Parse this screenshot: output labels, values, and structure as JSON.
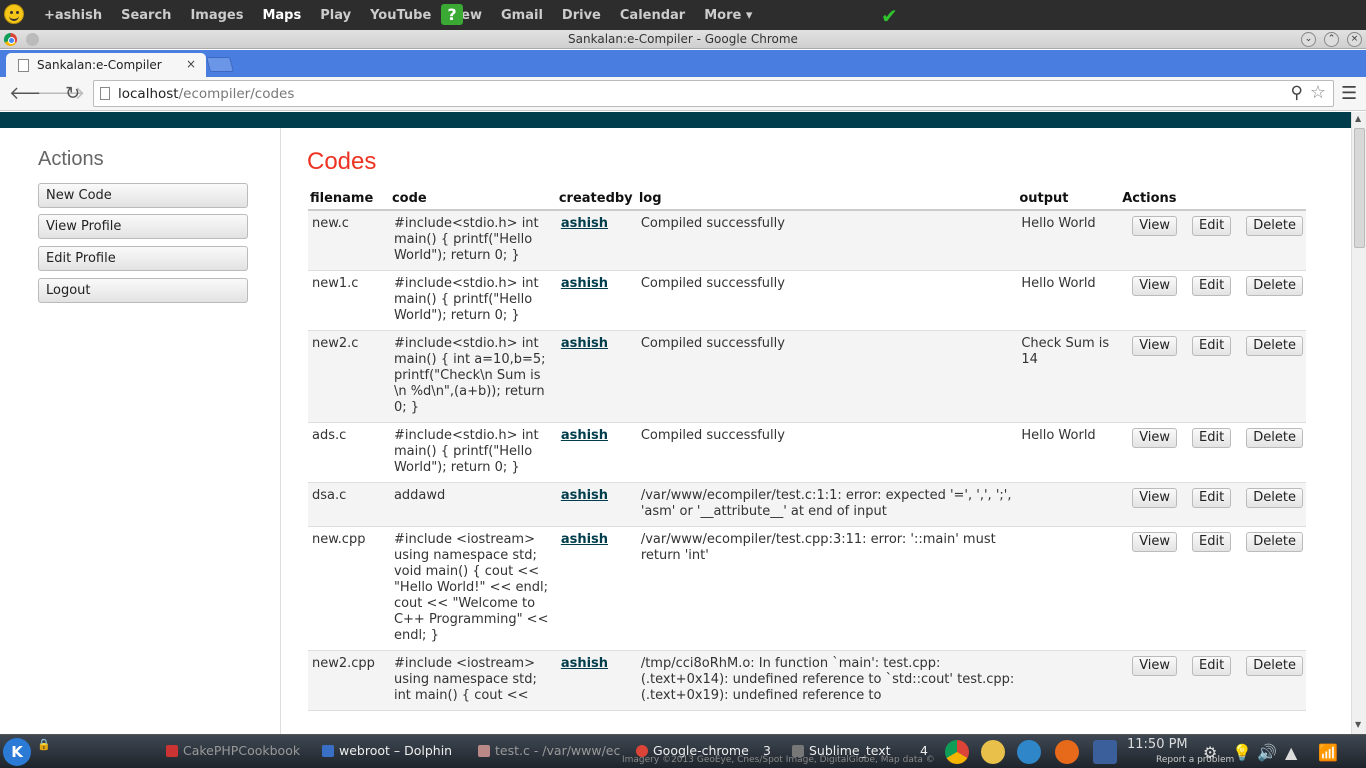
{
  "google_bar": {
    "links": [
      {
        "label": "+ashish",
        "active": false
      },
      {
        "label": "Search",
        "active": false
      },
      {
        "label": "Images",
        "active": false
      },
      {
        "label": "Maps",
        "active": true
      },
      {
        "label": "Play",
        "active": false
      },
      {
        "label": "YouTube",
        "active": false
      },
      {
        "label": "New",
        "active": false
      },
      {
        "label": "Gmail",
        "active": false
      },
      {
        "label": "Drive",
        "active": false
      },
      {
        "label": "Calendar",
        "active": false
      },
      {
        "label": "More ▾",
        "active": false
      }
    ],
    "icons": [
      "smiley-icon",
      "question-icon",
      "checkmark-icon"
    ]
  },
  "window": {
    "title": "Sankalan:e-Compiler - Google Chrome"
  },
  "tab": {
    "title": "Sankalan:e-Compiler",
    "close": "×"
  },
  "address_bar": {
    "host": "localhost",
    "path": "/ecompiler/codes"
  },
  "sidebar": {
    "heading": "Actions",
    "buttons": [
      "New Code",
      "View Profile",
      "Edit Profile",
      "Logout"
    ]
  },
  "main": {
    "heading": "Codes",
    "columns": [
      "filename",
      "code",
      "createdby",
      "log",
      "output",
      "Actions"
    ],
    "action_labels": {
      "view": "View",
      "edit": "Edit",
      "delete": "Delete"
    },
    "rows": [
      {
        "filename": "new.c",
        "code": "#include<stdio.h> int main() { printf(\"Hello World\"); return 0; }",
        "createdby": "ashish",
        "log": "Compiled successfully",
        "output": "Hello World"
      },
      {
        "filename": "new1.c",
        "code": "#include<stdio.h> int main() { printf(\"Hello World\"); return 0; }",
        "createdby": "ashish",
        "log": "Compiled successfully",
        "output": "Hello World"
      },
      {
        "filename": "new2.c",
        "code": "#include<stdio.h> int main() { int a=10,b=5; printf(\"Check\\n Sum is \\n %d\\n\",(a+b)); return 0; }",
        "createdby": "ashish",
        "log": "Compiled successfully",
        "output": "Check Sum is 14"
      },
      {
        "filename": "ads.c",
        "code": "#include<stdio.h> int main() { printf(\"Hello World\"); return 0; }",
        "createdby": "ashish",
        "log": "Compiled successfully",
        "output": "Hello World"
      },
      {
        "filename": "dsa.c",
        "code": "addawd",
        "createdby": "ashish",
        "log": "/var/www/ecompiler/test.c:1:1: error: expected '=', ',', ';', 'asm' or '__attribute__' at end of input",
        "output": ""
      },
      {
        "filename": "new.cpp",
        "code": "#include <iostream> using namespace std; void main() { cout << \"Hello World!\" << endl; cout << \"Welcome to C++ Programming\" << endl; }",
        "createdby": "ashish",
        "log": "/var/www/ecompiler/test.cpp:3:11: error: '::main' must return 'int'",
        "output": ""
      },
      {
        "filename": "new2.cpp",
        "code": "#include <iostream> using namespace std; int main() { cout <<",
        "createdby": "ashish",
        "log": "/tmp/cci8oRhM.o: In function `main': test.cpp:(.text+0x14): undefined reference to `std::cout' test.cpp:(.text+0x19): undefined reference to",
        "output": ""
      }
    ]
  },
  "taskbar": {
    "tasks": [
      {
        "label": "CakePHPCookbook",
        "dim": true
      },
      {
        "label": "webroot – Dolphin",
        "dim": false
      },
      {
        "label": "test.c - /var/www/ec",
        "dim": true
      },
      {
        "label": "Google-chrome",
        "dim": false
      },
      {
        "label": "Sublime_text",
        "dim": false
      }
    ],
    "badges": [
      "3",
      "4"
    ],
    "clock": "11:50 PM",
    "overlay_text": "Imagery ©2013 GeoEye, Cnes/Spot Image, DigitalGlobe, Map data ©",
    "report_text": "Report a problem"
  }
}
